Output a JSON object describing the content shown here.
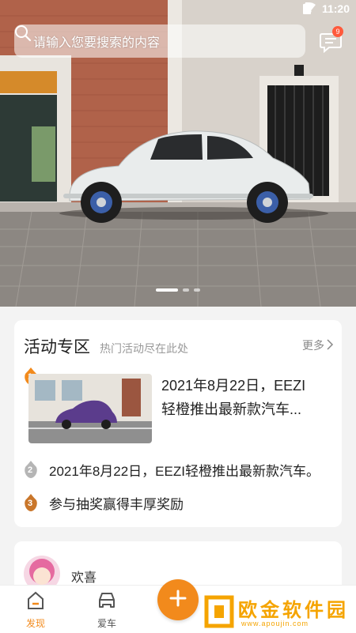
{
  "status_bar": {
    "time": "11:20"
  },
  "search": {
    "placeholder": "请输入您要搜索的内容"
  },
  "messages": {
    "badge_count": "9"
  },
  "banner": {
    "slide_count": 3,
    "active_slide": 1
  },
  "activity": {
    "title": "活动专区",
    "subtitle": "热门活动尽在此处",
    "more_label": "更多",
    "items": [
      {
        "rank": "1",
        "text_line1": "2021年8月22日，EEZI",
        "text_line2": "轻橙推出最新款汽车..."
      },
      {
        "rank": "2",
        "text": "2021年8月22日，EEZI轻橙推出最新款汽车。"
      },
      {
        "rank": "3",
        "text": "参与抽奖赢得丰厚奖励"
      }
    ]
  },
  "feed": {
    "user_name": "欢喜"
  },
  "nav": {
    "items": [
      {
        "label": "发现",
        "icon": "discover-icon",
        "active": true
      },
      {
        "label": "爱车",
        "icon": "car-icon",
        "active": false
      }
    ],
    "fab_icon": "plus-icon"
  },
  "watermark": {
    "title": "欧金软件园",
    "url": "www.apoujin.com"
  },
  "colors": {
    "accent": "#f28a1c",
    "badge": "#ff5a3c",
    "watermark": "#f5a400"
  }
}
